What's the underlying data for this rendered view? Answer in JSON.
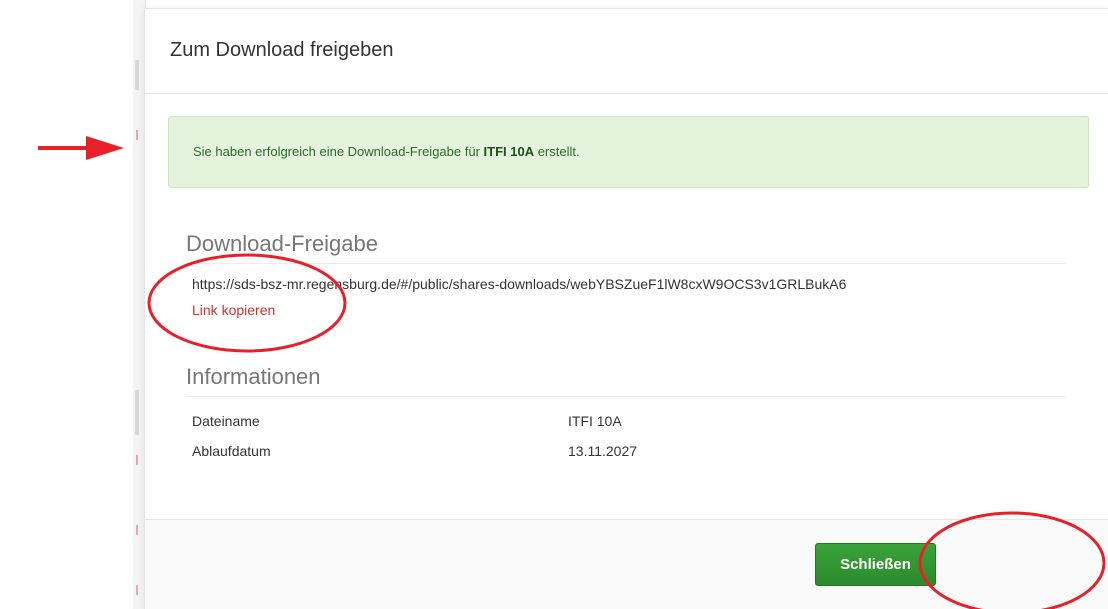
{
  "modal": {
    "title": "Zum Download freigeben",
    "alert": {
      "prefix": "Sie haben erfolgreich eine Download-Freigabe für ",
      "name": "ITFI 10A",
      "suffix": " erstellt."
    },
    "share_section": {
      "title": "Download-Freigabe",
      "url": "https://sds-bsz-mr.regensburg.de/#/public/shares-downloads/webYBSZueF1lW8cxW9OCS3v1GRLBukA6",
      "copy_link_label": "Link kopieren"
    },
    "info_section": {
      "title": "Informationen",
      "rows": [
        {
          "label": "Dateiname",
          "value": "ITFI 10A"
        },
        {
          "label": "Ablaufdatum",
          "value": "13.11.2027"
        }
      ]
    },
    "footer": {
      "close_label": "Schließen"
    }
  },
  "annotations": {
    "color": "#e8202a"
  },
  "colors": {
    "alert_bg": "#e4f4dc",
    "link_red": "#d9302c",
    "button_green": "#2f9a2f"
  }
}
